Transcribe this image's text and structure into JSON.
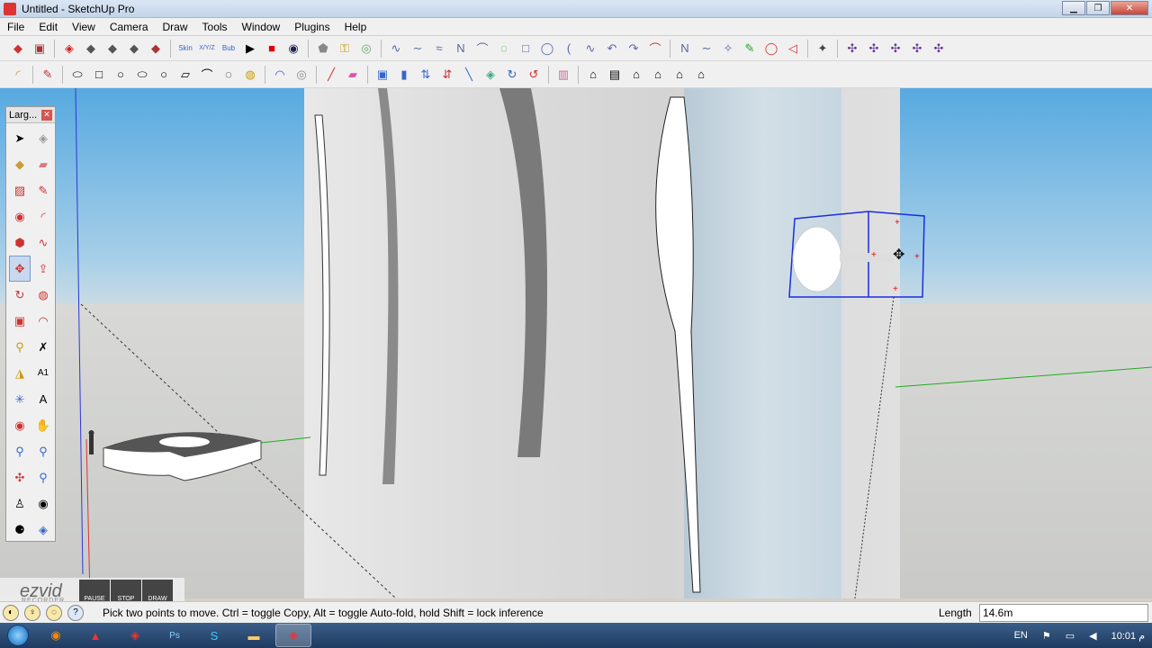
{
  "window": {
    "title": "Untitled - SketchUp Pro",
    "controls": [
      "minimize",
      "maximize",
      "close"
    ]
  },
  "menu": [
    "File",
    "Edit",
    "View",
    "Camera",
    "Draw",
    "Tools",
    "Window",
    "Plugins",
    "Help"
  ],
  "toolbar1": {
    "icons": [
      "box-icon",
      "pushpull-icon",
      "redcube-icon",
      "cube-icon",
      "cube-icon",
      "cube-icon",
      "cube-icon",
      "skin-icon",
      "xy-icon",
      "bub-icon",
      "play-icon",
      "stop-icon",
      "rotate-icon",
      "shield-icon",
      "key-icon",
      "ball-icon",
      "bezier-icon",
      "spline-icon",
      "curve-icon",
      "arc-icon",
      "arc-icon",
      "circle-icon",
      "circle-icon",
      "arc-icon",
      "line-icon",
      "curve-icon",
      "curve-icon",
      "arc-icon",
      "spline-icon",
      "polygon-icon",
      "wrench-icon",
      "circle-icon",
      "arc-icon",
      "sprocket-icon",
      "plugin-icon",
      "plugin-icon",
      "plugin-icon",
      "plugin-icon",
      "plugin-icon"
    ],
    "texts": {
      "skin": "Skin",
      "xy": "X/Y/Z",
      "bub": "Bub"
    }
  },
  "toolbar2": {
    "icons": [
      "lasso-icon",
      "pencil-icon",
      "shape-icon",
      "shape-icon",
      "shape-icon",
      "shape-icon",
      "shape-icon",
      "shape-icon",
      "shape-icon",
      "shape-icon",
      "loop-icon",
      "loop-icon",
      "eraser-icon",
      "eraser-icon",
      "cube-icon",
      "arrow-icon",
      "arrows-icon",
      "slash-icon",
      "box-icon",
      "rotate-icon",
      "rotate-icon",
      "paint-icon",
      "house-icon",
      "house-icon",
      "house-icon",
      "house-icon",
      "house-icon"
    ]
  },
  "tool_palette": {
    "title": "Larg...",
    "tools": [
      "select-icon",
      "component-icon",
      "paint-bucket-icon",
      "eraser-icon",
      "rectangle-icon",
      "line-icon",
      "circle-icon",
      "arc-icon",
      "polygon-icon",
      "freehand-icon",
      "move-icon",
      "pushpull-icon",
      "rotate-icon",
      "followme-icon",
      "scale-icon",
      "offset-icon",
      "tape-measure-icon",
      "dimension-icon",
      "protractor-icon",
      "text-icon",
      "axes-icon",
      "3d-text-icon",
      "orbit-icon",
      "pan-icon",
      "zoom-icon",
      "zoom-window-icon",
      "zoom-extents-icon",
      "previous-icon",
      "position-camera-icon",
      "look-around-icon",
      "walk-icon",
      "section-plane-icon"
    ],
    "active_index": 10
  },
  "ezvid": {
    "logo": "ezvid",
    "subtitle": "RECORDER",
    "pause": "PAUSE",
    "stop": "STOP",
    "draw": "DRAW"
  },
  "statusbar": {
    "message": "Pick two points to move.  Ctrl = toggle Copy, Alt = toggle Auto-fold, hold Shift = lock inference",
    "vcb_label": "Length",
    "vcb_value": "14.6m"
  },
  "taskbar": {
    "apps": [
      "firefox-icon",
      "acrobat-icon",
      "sketchup-icon",
      "photoshop-icon",
      "skype-icon",
      "folder-icon",
      "sketchup-icon"
    ],
    "tray": {
      "lang": "EN",
      "time": "10:01 م"
    }
  }
}
